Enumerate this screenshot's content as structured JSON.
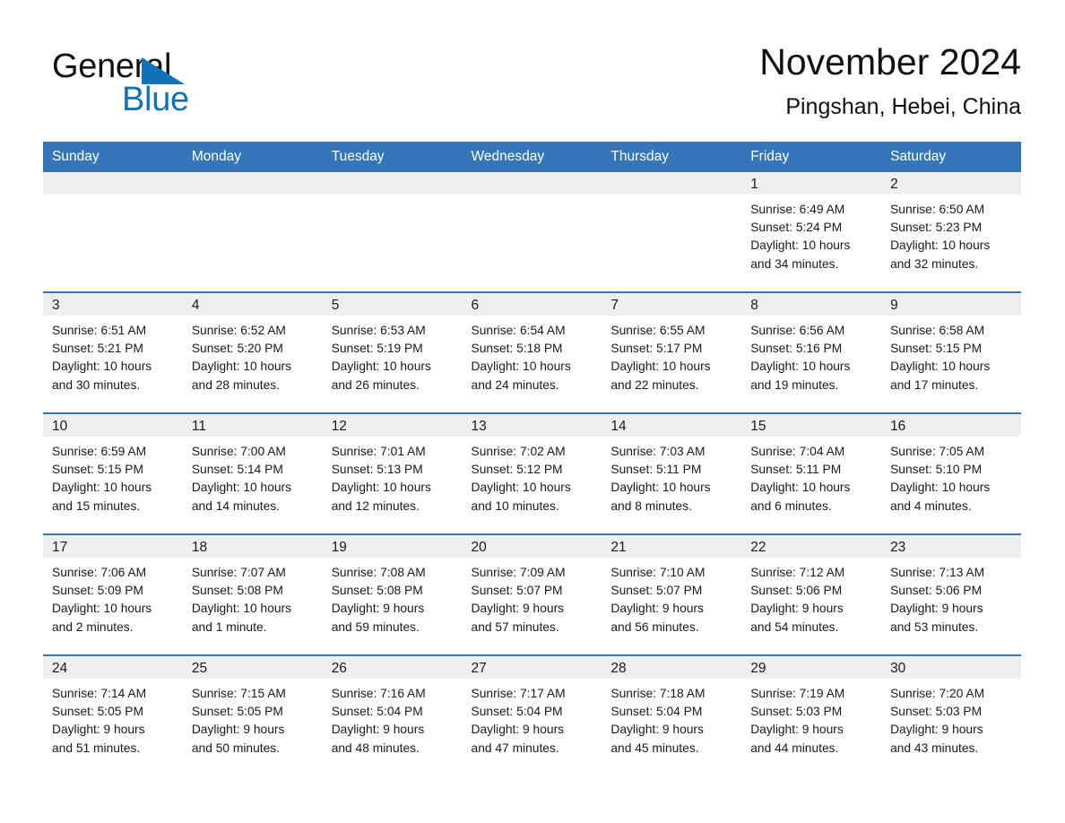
{
  "brand": {
    "name_part1": "General",
    "name_part2": "Blue",
    "triangle_color": "#1272b8"
  },
  "header": {
    "month_title": "November 2024",
    "location": "Pingshan, Hebei, China"
  },
  "theme": {
    "header_blue": "#3576b8",
    "daynum_band_gray": "#efefef",
    "separator_blue": "#3576b8",
    "text_color": "#1a1a1a"
  },
  "weekdays": [
    "Sunday",
    "Monday",
    "Tuesday",
    "Wednesday",
    "Thursday",
    "Friday",
    "Saturday"
  ],
  "weeks": [
    [
      {
        "empty": true
      },
      {
        "empty": true
      },
      {
        "empty": true
      },
      {
        "empty": true
      },
      {
        "empty": true
      },
      {
        "day": "1",
        "sunrise": "Sunrise: 6:49 AM",
        "sunset": "Sunset: 5:24 PM",
        "daylight_line1": "Daylight: 10 hours",
        "daylight_line2": "and 34 minutes."
      },
      {
        "day": "2",
        "sunrise": "Sunrise: 6:50 AM",
        "sunset": "Sunset: 5:23 PM",
        "daylight_line1": "Daylight: 10 hours",
        "daylight_line2": "and 32 minutes."
      }
    ],
    [
      {
        "day": "3",
        "sunrise": "Sunrise: 6:51 AM",
        "sunset": "Sunset: 5:21 PM",
        "daylight_line1": "Daylight: 10 hours",
        "daylight_line2": "and 30 minutes."
      },
      {
        "day": "4",
        "sunrise": "Sunrise: 6:52 AM",
        "sunset": "Sunset: 5:20 PM",
        "daylight_line1": "Daylight: 10 hours",
        "daylight_line2": "and 28 minutes."
      },
      {
        "day": "5",
        "sunrise": "Sunrise: 6:53 AM",
        "sunset": "Sunset: 5:19 PM",
        "daylight_line1": "Daylight: 10 hours",
        "daylight_line2": "and 26 minutes."
      },
      {
        "day": "6",
        "sunrise": "Sunrise: 6:54 AM",
        "sunset": "Sunset: 5:18 PM",
        "daylight_line1": "Daylight: 10 hours",
        "daylight_line2": "and 24 minutes."
      },
      {
        "day": "7",
        "sunrise": "Sunrise: 6:55 AM",
        "sunset": "Sunset: 5:17 PM",
        "daylight_line1": "Daylight: 10 hours",
        "daylight_line2": "and 22 minutes."
      },
      {
        "day": "8",
        "sunrise": "Sunrise: 6:56 AM",
        "sunset": "Sunset: 5:16 PM",
        "daylight_line1": "Daylight: 10 hours",
        "daylight_line2": "and 19 minutes."
      },
      {
        "day": "9",
        "sunrise": "Sunrise: 6:58 AM",
        "sunset": "Sunset: 5:15 PM",
        "daylight_line1": "Daylight: 10 hours",
        "daylight_line2": "and 17 minutes."
      }
    ],
    [
      {
        "day": "10",
        "sunrise": "Sunrise: 6:59 AM",
        "sunset": "Sunset: 5:15 PM",
        "daylight_line1": "Daylight: 10 hours",
        "daylight_line2": "and 15 minutes."
      },
      {
        "day": "11",
        "sunrise": "Sunrise: 7:00 AM",
        "sunset": "Sunset: 5:14 PM",
        "daylight_line1": "Daylight: 10 hours",
        "daylight_line2": "and 14 minutes."
      },
      {
        "day": "12",
        "sunrise": "Sunrise: 7:01 AM",
        "sunset": "Sunset: 5:13 PM",
        "daylight_line1": "Daylight: 10 hours",
        "daylight_line2": "and 12 minutes."
      },
      {
        "day": "13",
        "sunrise": "Sunrise: 7:02 AM",
        "sunset": "Sunset: 5:12 PM",
        "daylight_line1": "Daylight: 10 hours",
        "daylight_line2": "and 10 minutes."
      },
      {
        "day": "14",
        "sunrise": "Sunrise: 7:03 AM",
        "sunset": "Sunset: 5:11 PM",
        "daylight_line1": "Daylight: 10 hours",
        "daylight_line2": "and 8 minutes."
      },
      {
        "day": "15",
        "sunrise": "Sunrise: 7:04 AM",
        "sunset": "Sunset: 5:11 PM",
        "daylight_line1": "Daylight: 10 hours",
        "daylight_line2": "and 6 minutes."
      },
      {
        "day": "16",
        "sunrise": "Sunrise: 7:05 AM",
        "sunset": "Sunset: 5:10 PM",
        "daylight_line1": "Daylight: 10 hours",
        "daylight_line2": "and 4 minutes."
      }
    ],
    [
      {
        "day": "17",
        "sunrise": "Sunrise: 7:06 AM",
        "sunset": "Sunset: 5:09 PM",
        "daylight_line1": "Daylight: 10 hours",
        "daylight_line2": "and 2 minutes."
      },
      {
        "day": "18",
        "sunrise": "Sunrise: 7:07 AM",
        "sunset": "Sunset: 5:08 PM",
        "daylight_line1": "Daylight: 10 hours",
        "daylight_line2": "and 1 minute."
      },
      {
        "day": "19",
        "sunrise": "Sunrise: 7:08 AM",
        "sunset": "Sunset: 5:08 PM",
        "daylight_line1": "Daylight: 9 hours",
        "daylight_line2": "and 59 minutes."
      },
      {
        "day": "20",
        "sunrise": "Sunrise: 7:09 AM",
        "sunset": "Sunset: 5:07 PM",
        "daylight_line1": "Daylight: 9 hours",
        "daylight_line2": "and 57 minutes."
      },
      {
        "day": "21",
        "sunrise": "Sunrise: 7:10 AM",
        "sunset": "Sunset: 5:07 PM",
        "daylight_line1": "Daylight: 9 hours",
        "daylight_line2": "and 56 minutes."
      },
      {
        "day": "22",
        "sunrise": "Sunrise: 7:12 AM",
        "sunset": "Sunset: 5:06 PM",
        "daylight_line1": "Daylight: 9 hours",
        "daylight_line2": "and 54 minutes."
      },
      {
        "day": "23",
        "sunrise": "Sunrise: 7:13 AM",
        "sunset": "Sunset: 5:06 PM",
        "daylight_line1": "Daylight: 9 hours",
        "daylight_line2": "and 53 minutes."
      }
    ],
    [
      {
        "day": "24",
        "sunrise": "Sunrise: 7:14 AM",
        "sunset": "Sunset: 5:05 PM",
        "daylight_line1": "Daylight: 9 hours",
        "daylight_line2": "and 51 minutes."
      },
      {
        "day": "25",
        "sunrise": "Sunrise: 7:15 AM",
        "sunset": "Sunset: 5:05 PM",
        "daylight_line1": "Daylight: 9 hours",
        "daylight_line2": "and 50 minutes."
      },
      {
        "day": "26",
        "sunrise": "Sunrise: 7:16 AM",
        "sunset": "Sunset: 5:04 PM",
        "daylight_line1": "Daylight: 9 hours",
        "daylight_line2": "and 48 minutes."
      },
      {
        "day": "27",
        "sunrise": "Sunrise: 7:17 AM",
        "sunset": "Sunset: 5:04 PM",
        "daylight_line1": "Daylight: 9 hours",
        "daylight_line2": "and 47 minutes."
      },
      {
        "day": "28",
        "sunrise": "Sunrise: 7:18 AM",
        "sunset": "Sunset: 5:04 PM",
        "daylight_line1": "Daylight: 9 hours",
        "daylight_line2": "and 45 minutes."
      },
      {
        "day": "29",
        "sunrise": "Sunrise: 7:19 AM",
        "sunset": "Sunset: 5:03 PM",
        "daylight_line1": "Daylight: 9 hours",
        "daylight_line2": "and 44 minutes."
      },
      {
        "day": "30",
        "sunrise": "Sunrise: 7:20 AM",
        "sunset": "Sunset: 5:03 PM",
        "daylight_line1": "Daylight: 9 hours",
        "daylight_line2": "and 43 minutes."
      }
    ]
  ]
}
